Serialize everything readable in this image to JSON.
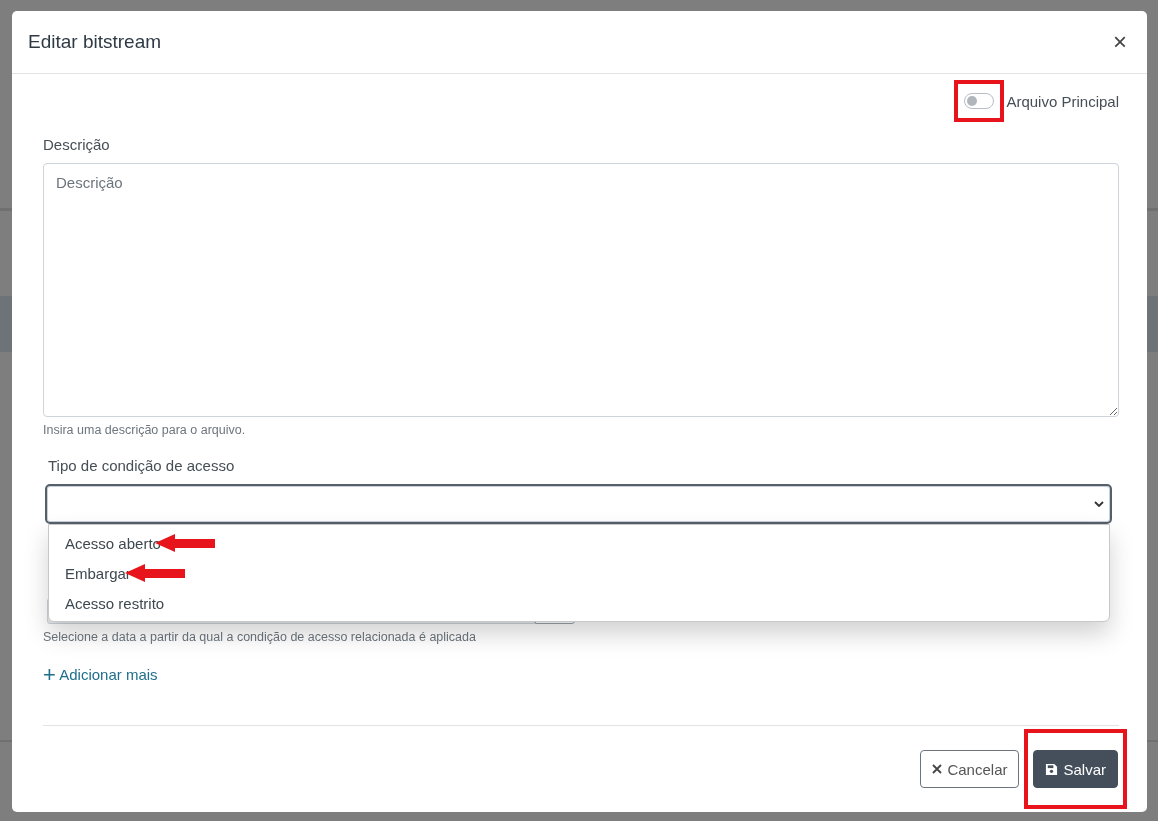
{
  "dialog": {
    "title": "Editar bitstream",
    "close": "×"
  },
  "primary_toggle": {
    "label": "Arquivo Principal",
    "on": false
  },
  "description": {
    "label": "Descrição",
    "placeholder": "Descrição",
    "help": "Insira uma descrição para o arquivo."
  },
  "access_condition": {
    "label": "Tipo de condição de acesso",
    "expanded": true,
    "options": [
      {
        "label": "Acesso aberto",
        "selected": false,
        "pointed": true
      },
      {
        "label": "Embargar",
        "selected": false,
        "pointed": true
      },
      {
        "label": "Acesso restrito",
        "selected": false,
        "pointed": false
      }
    ]
  },
  "date_help": "Selecione a data a partir da qual a condição de acesso relacionada é aplicada",
  "add_more": {
    "icon": "+",
    "label": "Adicionar mais"
  },
  "buttons": [
    {
      "kind": "cancel",
      "label": "Cancelar"
    },
    {
      "kind": "save",
      "label": "Salvar"
    }
  ]
}
